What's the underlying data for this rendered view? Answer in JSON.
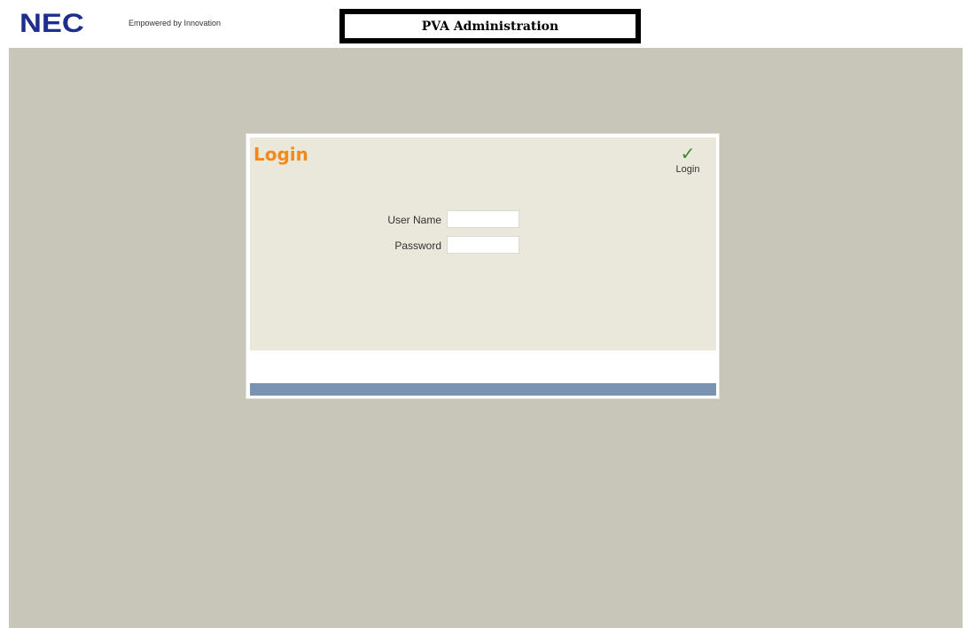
{
  "header": {
    "logo_text": "NEC",
    "tagline": "Empowered by Innovation",
    "title": "PVA Administration"
  },
  "login_dialog": {
    "title": "Login",
    "login_action_label": "Login",
    "login_action_icon": "check-icon",
    "fields": {
      "username": {
        "label": "User Name",
        "value": "",
        "placeholder": ""
      },
      "password": {
        "label": "Password",
        "value": "",
        "placeholder": ""
      }
    }
  },
  "colors": {
    "brand_blue": "#1d2e8c",
    "title_orange": "#f08a1a",
    "check_green": "#3a8a2a",
    "background_grey": "#c8c6b8",
    "dialog_panel": "#eae7db",
    "status_bar": "#7b93b3"
  }
}
